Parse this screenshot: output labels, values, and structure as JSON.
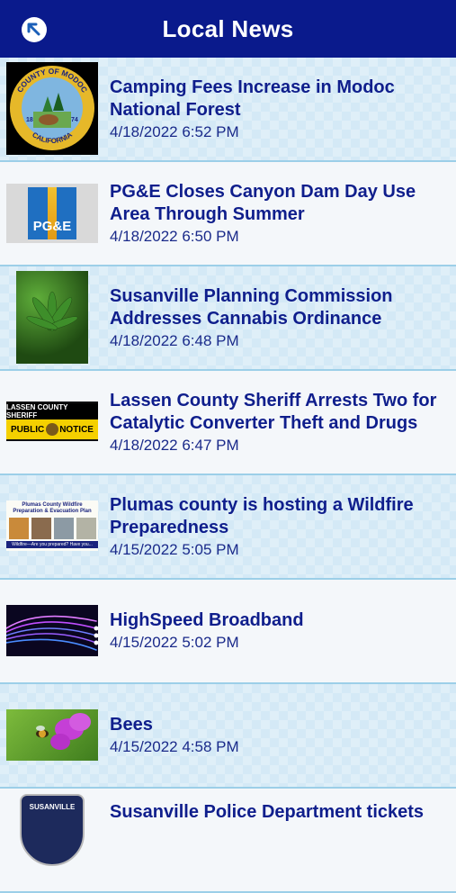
{
  "header": {
    "title": "Local News",
    "back_icon": "back-arrow-icon"
  },
  "articles": [
    {
      "headline": "Camping Fees Increase in Modoc National Forest",
      "date": "4/18/2022 6:52 PM",
      "thumb": "modoc-county-seal",
      "seal_top": "COUNTY OF MODOC",
      "seal_bottom": "CALIFORNIA",
      "seal_year_left": "18",
      "seal_year_right": "74"
    },
    {
      "headline": "PG&E Closes Canyon Dam Day Use Area Through Summer",
      "date": "4/18/2022 6:50 PM",
      "thumb": "pge-logo",
      "logo_text": "PG&E"
    },
    {
      "headline": "Susanville Planning Commission Addresses Cannabis Ordinance",
      "date": "4/18/2022 6:48 PM",
      "thumb": "cannabis-photo"
    },
    {
      "headline": "Lassen County Sheriff Arrests Two for Catalytic Converter Theft and Drugs",
      "date": "4/18/2022 6:47 PM",
      "thumb": "sheriff-notice",
      "notice_top": "LASSEN COUNTY SHERIFF",
      "notice_left": "PUBLIC",
      "notice_right": "NOTICE"
    },
    {
      "headline": "Plumas county is hosting a Wildfire Preparedness",
      "date": "4/15/2022 5:05 PM",
      "thumb": "wildfire-plan",
      "plan_title_1": "Plumas County Wildfire",
      "plan_title_2": "Preparation & Evacuation Plan",
      "plan_footer": "Wildfire—Are you prepared? Have you..."
    },
    {
      "headline": "HighSpeed Broadband",
      "date": "4/15/2022 5:02 PM",
      "thumb": "fiber-optic-photo"
    },
    {
      "headline": "Bees",
      "date": "4/15/2022 4:58 PM",
      "thumb": "bee-flower-photo"
    },
    {
      "headline": "Susanville Police Department tickets",
      "date": "",
      "thumb": "susanville-police-badge",
      "badge_text": "SUSANVILLE"
    }
  ]
}
